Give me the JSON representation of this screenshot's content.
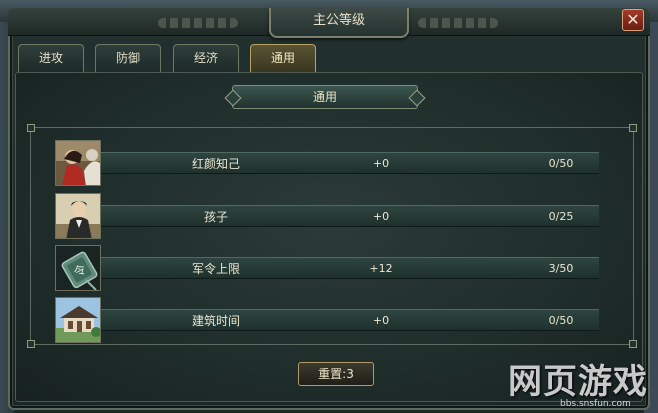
{
  "window": {
    "title": "主公等级",
    "close_label": "✕"
  },
  "tabs": [
    {
      "label": "进攻",
      "active": false
    },
    {
      "label": "防御",
      "active": false
    },
    {
      "label": "经济",
      "active": false
    },
    {
      "label": "通用",
      "active": true
    }
  ],
  "section": {
    "title": "通用"
  },
  "rows": [
    {
      "name": "红颜知己",
      "bonus": "+0",
      "level": "0/50",
      "icon": "beauty-portrait-icon"
    },
    {
      "name": "孩子",
      "bonus": "+0",
      "level": "0/25",
      "icon": "child-portrait-icon"
    },
    {
      "name": "军令上限",
      "bonus": "+12",
      "level": "3/50",
      "icon": "command-token-icon"
    },
    {
      "name": "建筑时间",
      "bonus": "+0",
      "level": "0/50",
      "icon": "building-icon"
    }
  ],
  "reset": {
    "label": "重置:3"
  },
  "watermark": {
    "main": "网页游戏",
    "sub": "bbs.snsfun.com"
  },
  "colors": {
    "accent": "#b6a466",
    "text": "#ece6d0",
    "close": "#a23b2a"
  }
}
